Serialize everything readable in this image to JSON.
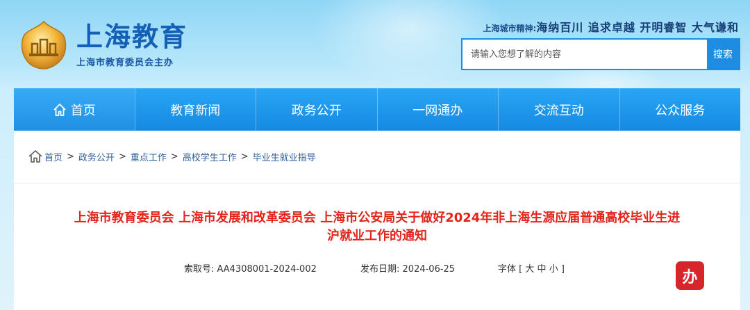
{
  "header": {
    "logo_title": "上海教育",
    "logo_subtitle": "上海市教育委员会主办",
    "spirit_label": "上海城市精神:",
    "spirit_text": "海纳百川 追求卓越 开明睿智 大气谦和"
  },
  "search": {
    "placeholder": "请输入您想了解的内容",
    "button_label": "搜索"
  },
  "nav": {
    "items": [
      {
        "label": "首页",
        "icon": "home-icon"
      },
      {
        "label": "教育新闻"
      },
      {
        "label": "政务公开"
      },
      {
        "label": "一网通办"
      },
      {
        "label": "交流互动"
      },
      {
        "label": "公众服务"
      }
    ]
  },
  "breadcrumb": {
    "icon": "home-icon",
    "items": [
      "首页",
      "政务公开",
      "重点工作",
      "高校学生工作",
      "毕业生就业指导"
    ],
    "separator": ">"
  },
  "document": {
    "title_line1": "上海市教育委员会 上海市发展和改革委员会 上海市公安局关于做好2024年非上海生源应届普通高校毕业生进",
    "title_line2": "沪就业工作的通知",
    "index_label": "索取号:",
    "index_value": "AA4308001-2024-002",
    "date_label": "发布日期:",
    "date_value": "2024-06-25",
    "font_label": "字体",
    "font_open": "[",
    "font_large": "大",
    "font_medium": "中",
    "font_small": "小",
    "font_close": "]"
  },
  "badge": {
    "label": "办"
  },
  "colors": {
    "nav_bg": "#1e8ce0",
    "title_red": "#e2241b",
    "brand_blue": "#1560b7",
    "badge_red": "#d6262b"
  }
}
